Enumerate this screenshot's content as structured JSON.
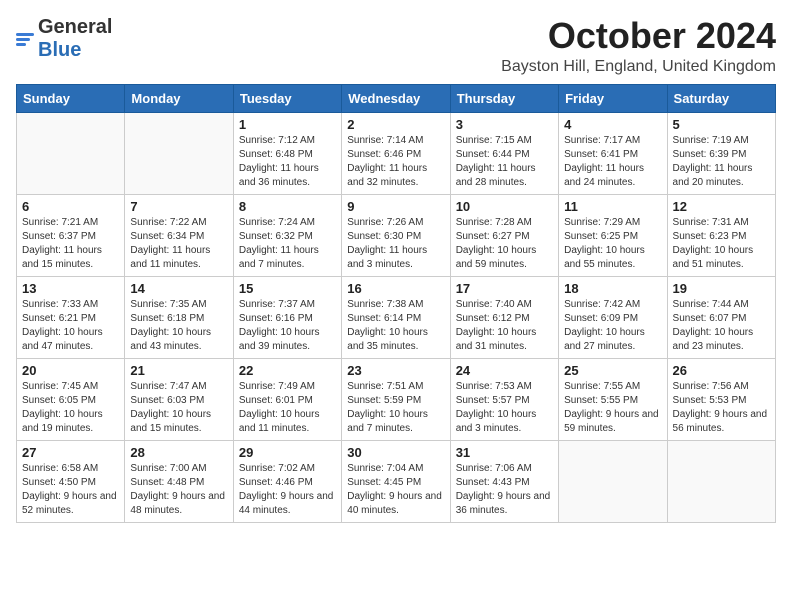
{
  "header": {
    "logo_general": "General",
    "logo_blue": "Blue",
    "month_title": "October 2024",
    "location": "Bayston Hill, England, United Kingdom"
  },
  "days": [
    "Sunday",
    "Monday",
    "Tuesday",
    "Wednesday",
    "Thursday",
    "Friday",
    "Saturday"
  ],
  "weeks": [
    [
      {
        "date": "",
        "sunrise": "",
        "sunset": "",
        "daylight": ""
      },
      {
        "date": "",
        "sunrise": "",
        "sunset": "",
        "daylight": ""
      },
      {
        "date": "1",
        "sunrise": "Sunrise: 7:12 AM",
        "sunset": "Sunset: 6:48 PM",
        "daylight": "Daylight: 11 hours and 36 minutes."
      },
      {
        "date": "2",
        "sunrise": "Sunrise: 7:14 AM",
        "sunset": "Sunset: 6:46 PM",
        "daylight": "Daylight: 11 hours and 32 minutes."
      },
      {
        "date": "3",
        "sunrise": "Sunrise: 7:15 AM",
        "sunset": "Sunset: 6:44 PM",
        "daylight": "Daylight: 11 hours and 28 minutes."
      },
      {
        "date": "4",
        "sunrise": "Sunrise: 7:17 AM",
        "sunset": "Sunset: 6:41 PM",
        "daylight": "Daylight: 11 hours and 24 minutes."
      },
      {
        "date": "5",
        "sunrise": "Sunrise: 7:19 AM",
        "sunset": "Sunset: 6:39 PM",
        "daylight": "Daylight: 11 hours and 20 minutes."
      }
    ],
    [
      {
        "date": "6",
        "sunrise": "Sunrise: 7:21 AM",
        "sunset": "Sunset: 6:37 PM",
        "daylight": "Daylight: 11 hours and 15 minutes."
      },
      {
        "date": "7",
        "sunrise": "Sunrise: 7:22 AM",
        "sunset": "Sunset: 6:34 PM",
        "daylight": "Daylight: 11 hours and 11 minutes."
      },
      {
        "date": "8",
        "sunrise": "Sunrise: 7:24 AM",
        "sunset": "Sunset: 6:32 PM",
        "daylight": "Daylight: 11 hours and 7 minutes."
      },
      {
        "date": "9",
        "sunrise": "Sunrise: 7:26 AM",
        "sunset": "Sunset: 6:30 PM",
        "daylight": "Daylight: 11 hours and 3 minutes."
      },
      {
        "date": "10",
        "sunrise": "Sunrise: 7:28 AM",
        "sunset": "Sunset: 6:27 PM",
        "daylight": "Daylight: 10 hours and 59 minutes."
      },
      {
        "date": "11",
        "sunrise": "Sunrise: 7:29 AM",
        "sunset": "Sunset: 6:25 PM",
        "daylight": "Daylight: 10 hours and 55 minutes."
      },
      {
        "date": "12",
        "sunrise": "Sunrise: 7:31 AM",
        "sunset": "Sunset: 6:23 PM",
        "daylight": "Daylight: 10 hours and 51 minutes."
      }
    ],
    [
      {
        "date": "13",
        "sunrise": "Sunrise: 7:33 AM",
        "sunset": "Sunset: 6:21 PM",
        "daylight": "Daylight: 10 hours and 47 minutes."
      },
      {
        "date": "14",
        "sunrise": "Sunrise: 7:35 AM",
        "sunset": "Sunset: 6:18 PM",
        "daylight": "Daylight: 10 hours and 43 minutes."
      },
      {
        "date": "15",
        "sunrise": "Sunrise: 7:37 AM",
        "sunset": "Sunset: 6:16 PM",
        "daylight": "Daylight: 10 hours and 39 minutes."
      },
      {
        "date": "16",
        "sunrise": "Sunrise: 7:38 AM",
        "sunset": "Sunset: 6:14 PM",
        "daylight": "Daylight: 10 hours and 35 minutes."
      },
      {
        "date": "17",
        "sunrise": "Sunrise: 7:40 AM",
        "sunset": "Sunset: 6:12 PM",
        "daylight": "Daylight: 10 hours and 31 minutes."
      },
      {
        "date": "18",
        "sunrise": "Sunrise: 7:42 AM",
        "sunset": "Sunset: 6:09 PM",
        "daylight": "Daylight: 10 hours and 27 minutes."
      },
      {
        "date": "19",
        "sunrise": "Sunrise: 7:44 AM",
        "sunset": "Sunset: 6:07 PM",
        "daylight": "Daylight: 10 hours and 23 minutes."
      }
    ],
    [
      {
        "date": "20",
        "sunrise": "Sunrise: 7:45 AM",
        "sunset": "Sunset: 6:05 PM",
        "daylight": "Daylight: 10 hours and 19 minutes."
      },
      {
        "date": "21",
        "sunrise": "Sunrise: 7:47 AM",
        "sunset": "Sunset: 6:03 PM",
        "daylight": "Daylight: 10 hours and 15 minutes."
      },
      {
        "date": "22",
        "sunrise": "Sunrise: 7:49 AM",
        "sunset": "Sunset: 6:01 PM",
        "daylight": "Daylight: 10 hours and 11 minutes."
      },
      {
        "date": "23",
        "sunrise": "Sunrise: 7:51 AM",
        "sunset": "Sunset: 5:59 PM",
        "daylight": "Daylight: 10 hours and 7 minutes."
      },
      {
        "date": "24",
        "sunrise": "Sunrise: 7:53 AM",
        "sunset": "Sunset: 5:57 PM",
        "daylight": "Daylight: 10 hours and 3 minutes."
      },
      {
        "date": "25",
        "sunrise": "Sunrise: 7:55 AM",
        "sunset": "Sunset: 5:55 PM",
        "daylight": "Daylight: 9 hours and 59 minutes."
      },
      {
        "date": "26",
        "sunrise": "Sunrise: 7:56 AM",
        "sunset": "Sunset: 5:53 PM",
        "daylight": "Daylight: 9 hours and 56 minutes."
      }
    ],
    [
      {
        "date": "27",
        "sunrise": "Sunrise: 6:58 AM",
        "sunset": "Sunset: 4:50 PM",
        "daylight": "Daylight: 9 hours and 52 minutes."
      },
      {
        "date": "28",
        "sunrise": "Sunrise: 7:00 AM",
        "sunset": "Sunset: 4:48 PM",
        "daylight": "Daylight: 9 hours and 48 minutes."
      },
      {
        "date": "29",
        "sunrise": "Sunrise: 7:02 AM",
        "sunset": "Sunset: 4:46 PM",
        "daylight": "Daylight: 9 hours and 44 minutes."
      },
      {
        "date": "30",
        "sunrise": "Sunrise: 7:04 AM",
        "sunset": "Sunset: 4:45 PM",
        "daylight": "Daylight: 9 hours and 40 minutes."
      },
      {
        "date": "31",
        "sunrise": "Sunrise: 7:06 AM",
        "sunset": "Sunset: 4:43 PM",
        "daylight": "Daylight: 9 hours and 36 minutes."
      },
      {
        "date": "",
        "sunrise": "",
        "sunset": "",
        "daylight": ""
      },
      {
        "date": "",
        "sunrise": "",
        "sunset": "",
        "daylight": ""
      }
    ]
  ]
}
